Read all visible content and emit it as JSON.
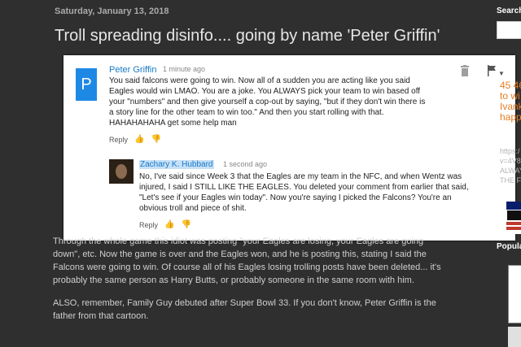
{
  "post": {
    "date": "Saturday, January 13, 2018",
    "title": "Troll spreading disinfo.... going by name 'Peter Griffin'",
    "paragraph1": "Through the whole game this idiot was posting \"your Eagles are losing, your Eagles are going down\", etc.  Now the game is over and the Eagles won, and he is posting this, stating I said the Falcons were going to win.  Of course all of his Eagles losing trolling posts have been deleted... it's probably the same person as Harry Butts, or probably someone in the same room with him.",
    "paragraph2": "ALSO, remember, Family Guy debuted after Super Bowl 33.  If you don't know, Peter Griffin is the father from that cartoon."
  },
  "screenshot": {
    "comment": {
      "avatar_letter": "P",
      "avatar_color": "#1e88e5",
      "author": "Peter Griffin",
      "time": "1 minute ago",
      "text": "You said falcons were going to win. Now all of a sudden you are acting like you said Eagles would win LMAO. You are a joke. You ALWAYS pick your team to win based off your \"numbers\" and then give yourself a cop-out by saying, \"but if they don't win there is a story line for the other team to win too.\" And then you start rolling with that. HAHAHAHAHA get some help man",
      "reply_label": "Reply",
      "like_icon": "thumbs-up-icon",
      "dislike_icon": "thumbs-down-icon",
      "trash_icon": "trash-icon",
      "flag_icon": "flag-icon"
    },
    "reply": {
      "author": "Zachary K. Hubbard",
      "time": "1 second ago",
      "text": "No, I've said since Week 3 that the Eagles are my team in the NFC, and when Wentz was injured, I said I STILL LIKE THE EAGLES.  You deleted your comment from earlier that said, \"Let's see if your Eagles win today\".  Now you're saying I picked the Falcons?  You're an obvious troll and piece of shit.",
      "reply_label": "Reply"
    }
  },
  "sidebar": {
    "search_heading": "Search",
    "orange_lines": [
      "45 46",
      "to wi",
      "Ivank",
      "happ"
    ],
    "grey_lines": [
      "https:/",
      "v=4V8",
      "ALWAY",
      "THE F"
    ],
    "popular_heading": "Popular"
  },
  "colors": {
    "page_bg": "#2f2f2f",
    "link_blue": "#167ac6",
    "accent_orange": "#e67e22"
  }
}
